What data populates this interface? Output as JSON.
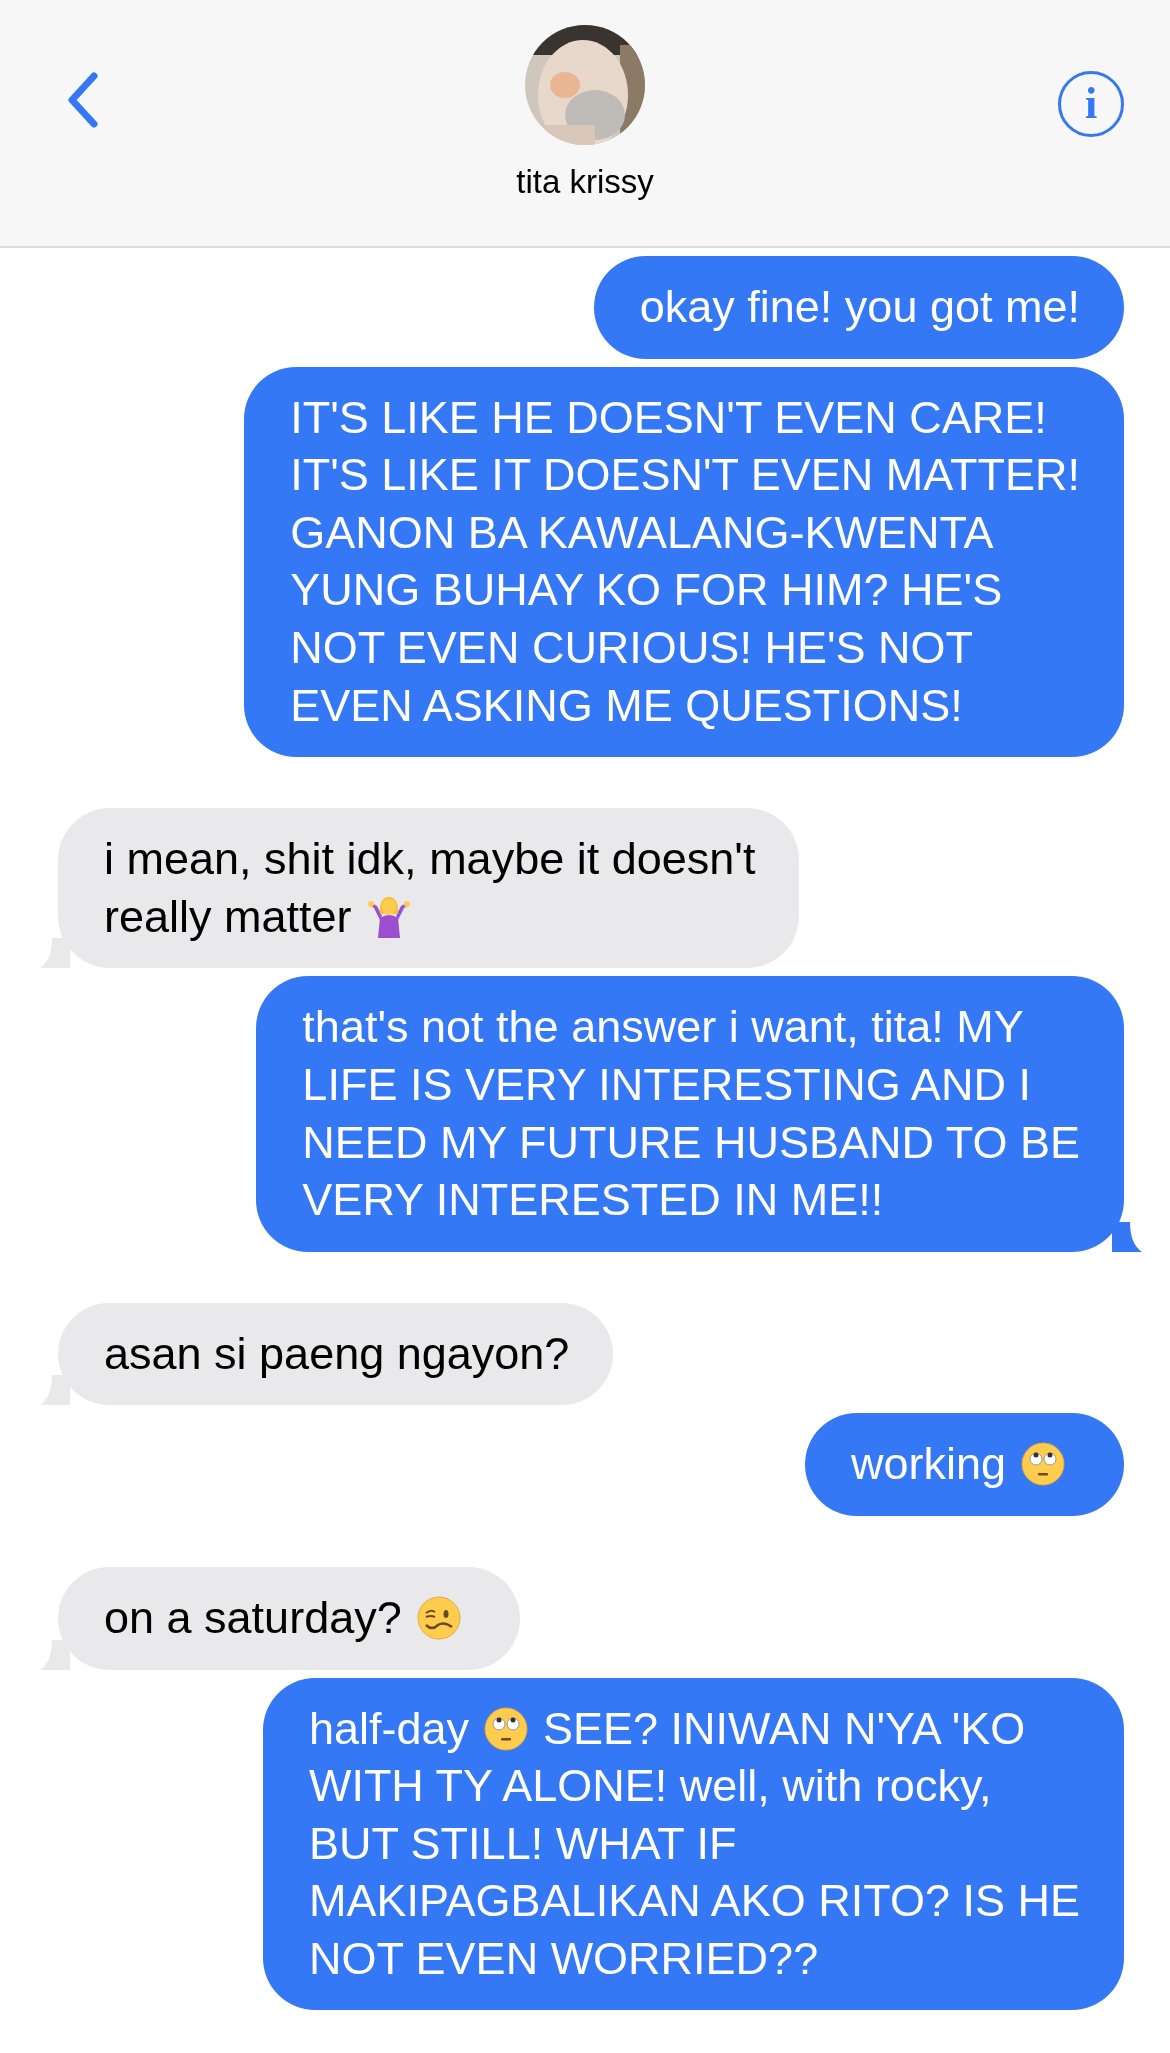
{
  "header": {
    "contact_name": "tita krissy",
    "info": "i"
  },
  "messages": [
    {
      "kind": "sent",
      "tail": false,
      "lines": [
        "okay fine! you got me!"
      ]
    },
    {
      "kind": "sent",
      "tail": false,
      "lines": [
        "IT'S LIKE HE DOESN'T EVEN CARE!",
        "IT'S LIKE IT DOESN'T EVEN MATTER!",
        "GANON BA KAWALANG-KWENTA",
        "YUNG BUHAY KO FOR HIM? HE'S",
        "NOT EVEN CURIOUS! HE'S NOT",
        "EVEN ASKING ME QUESTIONS!"
      ]
    },
    {
      "kind": "received",
      "tail": true,
      "lines": [
        "i mean, shit idk, maybe it doesn't",
        [
          {
            "kind": "text",
            "text": "really matter"
          },
          {
            "kind": "shrug"
          }
        ]
      ]
    },
    {
      "kind": "sent",
      "tail": true,
      "lines": [
        "that's not the answer i want, tita! MY",
        "LIFE IS VERY INTERESTING AND I",
        "NEED MY FUTURE HUSBAND TO BE",
        "VERY INTERESTED IN ME!!"
      ]
    },
    {
      "kind": "received",
      "tail": true,
      "lines": [
        "asan si paeng ngayon?"
      ]
    },
    {
      "kind": "sent",
      "tail": false,
      "lines": [
        [
          {
            "kind": "text",
            "text": "working"
          },
          {
            "kind": "eyeroll"
          }
        ]
      ]
    },
    {
      "kind": "received",
      "tail": true,
      "lines": [
        [
          {
            "kind": "text",
            "text": "on a saturday?"
          },
          {
            "kind": "woozy"
          }
        ]
      ]
    },
    {
      "kind": "sent",
      "tail": false,
      "lines": [
        [
          {
            "kind": "text",
            "text": "half-day"
          },
          {
            "kind": "eyeroll"
          },
          {
            "kind": "text",
            "text": "SEE? INIWAN N'YA 'KO"
          }
        ],
        "WITH TY ALONE! well, with rocky,",
        "BUT STILL! WHAT IF",
        "MAKIPAGBALIKAN AKO RITO? IS HE",
        "NOT EVEN WORRIED??"
      ]
    }
  ]
}
